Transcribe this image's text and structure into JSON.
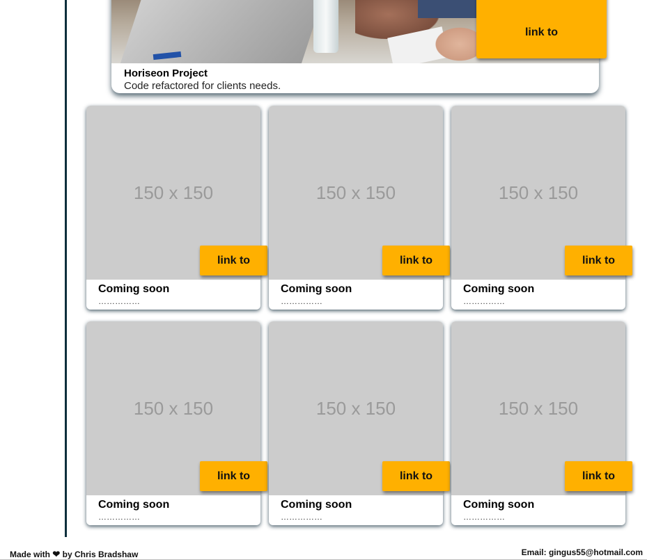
{
  "featured": {
    "title": "Horiseon Project",
    "description": "Code refactored for clients needs.",
    "link_label": "link to"
  },
  "cards": [
    {
      "placeholder": "150 x 150",
      "link_label": "link to",
      "title": "Coming soon",
      "dots": "……………"
    },
    {
      "placeholder": "150 x 150",
      "link_label": "link to",
      "title": "Coming soon",
      "dots": "……………"
    },
    {
      "placeholder": "150 x 150",
      "link_label": "link to",
      "title": "Coming soon",
      "dots": "……………"
    },
    {
      "placeholder": "150 x 150",
      "link_label": "link to",
      "title": "Coming soon",
      "dots": "……………"
    },
    {
      "placeholder": "150 x 150",
      "link_label": "link to",
      "title": "Coming soon",
      "dots": "……………"
    },
    {
      "placeholder": "150 x 150",
      "link_label": "link to",
      "title": "Coming soon",
      "dots": "……………"
    }
  ],
  "footer": {
    "made_with": "Made with",
    "heart_icon": "heart-icon",
    "by_author": "by Chris Bradshaw",
    "email": "Email: gingus55@hotmail.com"
  },
  "colors": {
    "accent": "#ffb000",
    "sidebar_line": "#0e2f3c",
    "placeholder_bg": "#cccccc"
  }
}
